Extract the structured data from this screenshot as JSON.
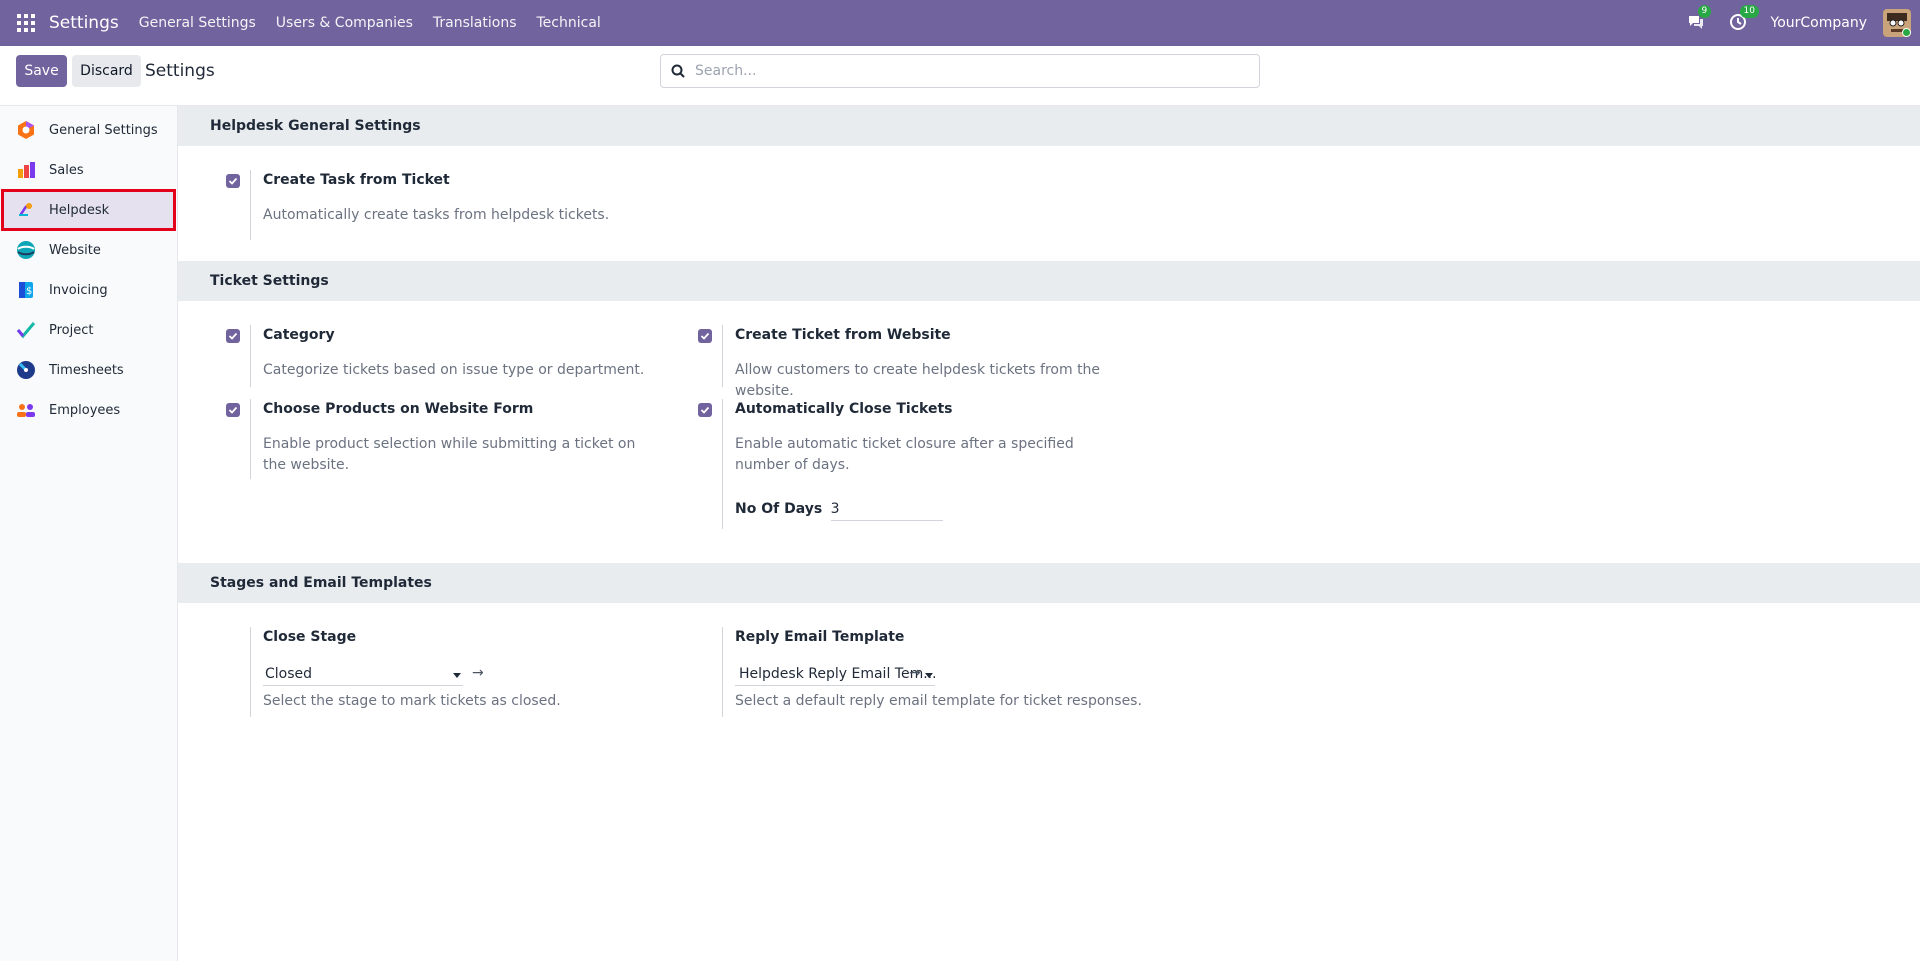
{
  "topbar": {
    "brand": "Settings",
    "nav": [
      "General Settings",
      "Users & Companies",
      "Translations",
      "Technical"
    ],
    "messages_count": "9",
    "activities_count": "10",
    "company": "YourCompany"
  },
  "controls": {
    "save_label": "Save",
    "discard_label": "Discard",
    "page_title": "Settings",
    "search_placeholder": "Search..."
  },
  "sidebar": {
    "items": [
      {
        "label": "General Settings",
        "icon": "general-settings-icon"
      },
      {
        "label": "Sales",
        "icon": "sales-icon"
      },
      {
        "label": "Helpdesk",
        "icon": "helpdesk-icon",
        "active": true
      },
      {
        "label": "Website",
        "icon": "website-icon"
      },
      {
        "label": "Invoicing",
        "icon": "invoicing-icon"
      },
      {
        "label": "Project",
        "icon": "project-icon"
      },
      {
        "label": "Timesheets",
        "icon": "timesheets-icon"
      },
      {
        "label": "Employees",
        "icon": "employees-icon"
      }
    ]
  },
  "sections": {
    "general": {
      "title": "Helpdesk General Settings",
      "task": {
        "label": "Create Task from Ticket",
        "desc": "Automatically create tasks from helpdesk tickets.",
        "checked": true
      }
    },
    "ticket": {
      "title": "Ticket Settings",
      "category": {
        "label": "Category",
        "desc": "Categorize tickets based on issue type or department.",
        "checked": true
      },
      "website_ticket": {
        "label": "Create Ticket from Website",
        "desc": "Allow customers to create helpdesk tickets from the website.",
        "checked": true
      },
      "products": {
        "label": "Choose Products on Website Form",
        "desc": "Enable product selection while submitting a ticket on the website.",
        "checked": true
      },
      "auto_close": {
        "label": "Automatically Close Tickets",
        "desc": "Enable automatic ticket closure after a specified number of days.",
        "checked": true,
        "days_label": "No Of Days",
        "days_value": "3"
      }
    },
    "stages": {
      "title": "Stages and Email Templates",
      "close_stage": {
        "label": "Close Stage",
        "value": "Closed",
        "desc": "Select the stage to mark tickets as closed."
      },
      "reply_template": {
        "label": "Reply Email Template",
        "value": "Helpdesk Reply Email Tem...",
        "desc": "Select a default reply email template for ticket responses."
      }
    }
  },
  "colors": {
    "brand": "#71639e",
    "highlight": "#e3001b"
  }
}
